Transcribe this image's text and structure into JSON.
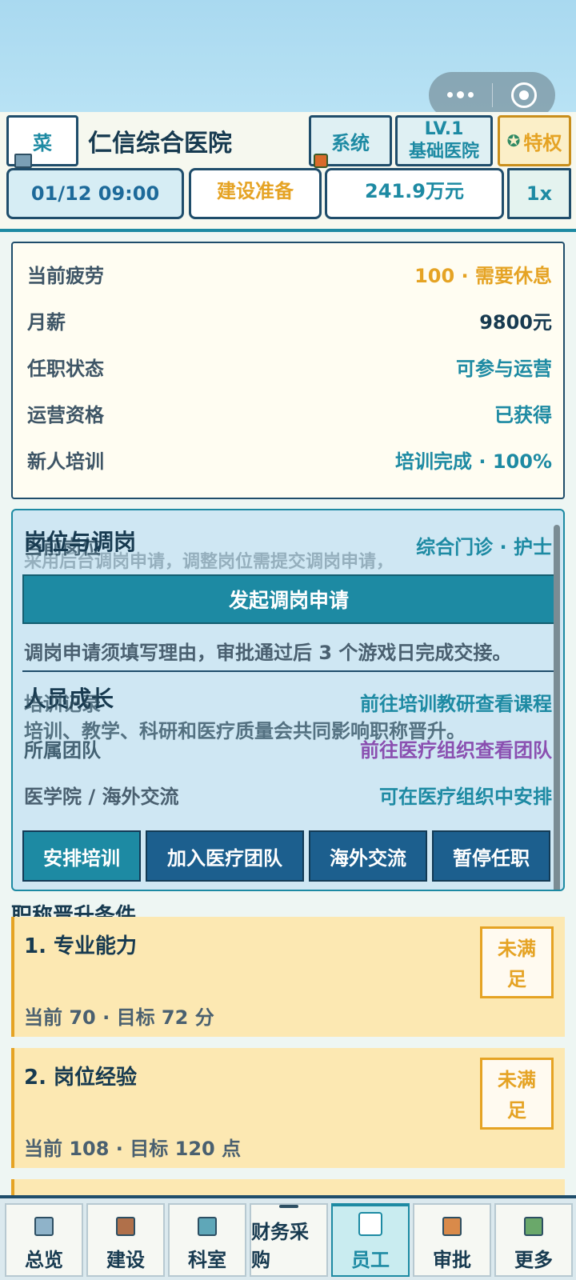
{
  "header": {
    "menu_label": "菜",
    "hospital_name": "仁信综合医院",
    "system_label": "系统",
    "level_line1": "LV.1",
    "level_line2": "基础医院",
    "privilege_label": "特权",
    "datetime": "01/12 09:00",
    "phase": "建设准备",
    "funds": "241.9万元",
    "speed": "1x"
  },
  "status_card": {
    "rows": [
      {
        "label": "当前疲劳",
        "value": "100 · 需要休息"
      },
      {
        "label": "月薪",
        "value": "9800元"
      },
      {
        "label": "任职状态",
        "value": "可参与运营"
      },
      {
        "label": "运营资格",
        "value": "已获得"
      },
      {
        "label": "新人培训",
        "value": "培训完成 · 100%"
      }
    ]
  },
  "position": {
    "ghost_label": "当前岗位",
    "ghost_text": "采用后台调岗申请，调整岗位需提交调岗申请，",
    "title": "岗位与调岗",
    "current": "综合门诊 · 护士",
    "transfer_button": "发起调岗申请",
    "note": "调岗申请须填写理由，审批通过后 3 个游戏日完成交接。"
  },
  "growth": {
    "title": "人员成长",
    "training_label": "培训记录",
    "training_link": "前往培训教研查看课程",
    "note": "培训、教学、科研和医疗质量会共同影响职称晋升。",
    "team_label": "所属团队",
    "team_link": "前往医疗组织查看团队",
    "exchange_label": "医学院 / 海外交流",
    "exchange_link": "可在医疗组织中安排",
    "actions": [
      "安排培训",
      "加入医疗团队",
      "海外交流",
      "暂停任职"
    ]
  },
  "promotion": {
    "title": "职称晋升条件",
    "conditions": [
      {
        "title": "1. 专业能力",
        "status_line1": "未满",
        "status_line2": "足",
        "detail": "当前 70 · 目标 72 分"
      },
      {
        "title": "2. 岗位经验",
        "status_line1": "未满",
        "status_line2": "足",
        "detail": "当前 108 · 目标 120 点"
      }
    ]
  },
  "tabs": [
    {
      "label": "总览",
      "icon": "hospital-icon"
    },
    {
      "label": "建设",
      "icon": "crane-icon"
    },
    {
      "label": "科室",
      "icon": "department-icon"
    },
    {
      "label": "财务采购",
      "icon": "finance-icon"
    },
    {
      "label": "员工",
      "icon": "doctor-icon"
    },
    {
      "label": "审批",
      "icon": "approval-icon"
    },
    {
      "label": "更多",
      "icon": "more-icon"
    }
  ],
  "colors": {
    "accent": "#1d8aa3",
    "warning": "#e5a324",
    "dark": "#173a50",
    "purple": "#8a4fb0"
  }
}
